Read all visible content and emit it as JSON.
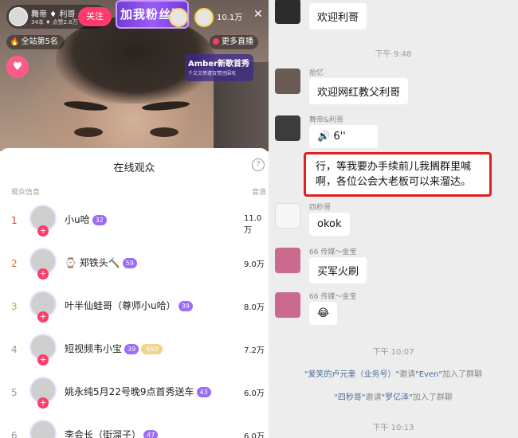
{
  "live": {
    "host_name": "舞帝 ♦ 利哥",
    "host_sub": "34本 ♦ 点赞2.6万",
    "follow_label": "关注",
    "fan_banner": "加我粉丝团",
    "viewers": "10.1万",
    "rank": "全站第5名",
    "more_live": "更多直播",
    "event_title": "Amber新歌首秀",
    "event_sub": "千文文惨遭百赞团围攻",
    "gift_icon": "gift-icon"
  },
  "audience": {
    "title": "在线观众",
    "col_left": "观众信息",
    "col_right": "音浪",
    "rows": [
      {
        "rank": "1",
        "name": "小u哈",
        "badge": "32",
        "value": "11.0万"
      },
      {
        "rank": "2",
        "name": "⌚ 郑铁头🔨",
        "badge": "59",
        "value": "9.0万"
      },
      {
        "rank": "3",
        "name": "叶半仙蛙哥（尊师小u哈）",
        "badge": "39",
        "value": "8.0万"
      },
      {
        "rank": "4",
        "name": "短视频韦小宝",
        "badge": "39",
        "badge2": "650",
        "value": "7.2万"
      },
      {
        "rank": "5",
        "name": "姚永纯5月22号晚9点首秀送车",
        "badge": "43",
        "value": "6.0万"
      },
      {
        "rank": "6",
        "name": "李会长（街溜子）",
        "badge": "47",
        "value": "6.0万"
      }
    ]
  },
  "chat": {
    "msg0": "欢迎利哥",
    "time1": "下午 9:48",
    "sender1": "拾忆",
    "msg1": "欢迎网红教父利哥",
    "sender2": "舞帝&利哥",
    "msg2": "6''",
    "msg3": "行，等我要办手续前儿我搁群里喊啊，各位公会大老板可以来溜达。",
    "sender4": "四秒哥",
    "msg4": "okok",
    "sender5": "66 传媒～金宝",
    "msg5": "买军火刷",
    "sender6": "66 传媒～金宝",
    "msg6": "😂",
    "time2": "下午 10:07",
    "sys1_a": "\"爱笑的卢元奎（业务号）\"",
    "sys1_b": "邀请",
    "sys1_c": "\"Even\"",
    "sys1_d": "加入了群聊",
    "sys2_a": "\"四秒哥\"",
    "sys2_b": "邀请",
    "sys2_c": "\"罗亿泽\"",
    "sys2_d": "加入了群聊",
    "time3": "下午 10:13"
  }
}
